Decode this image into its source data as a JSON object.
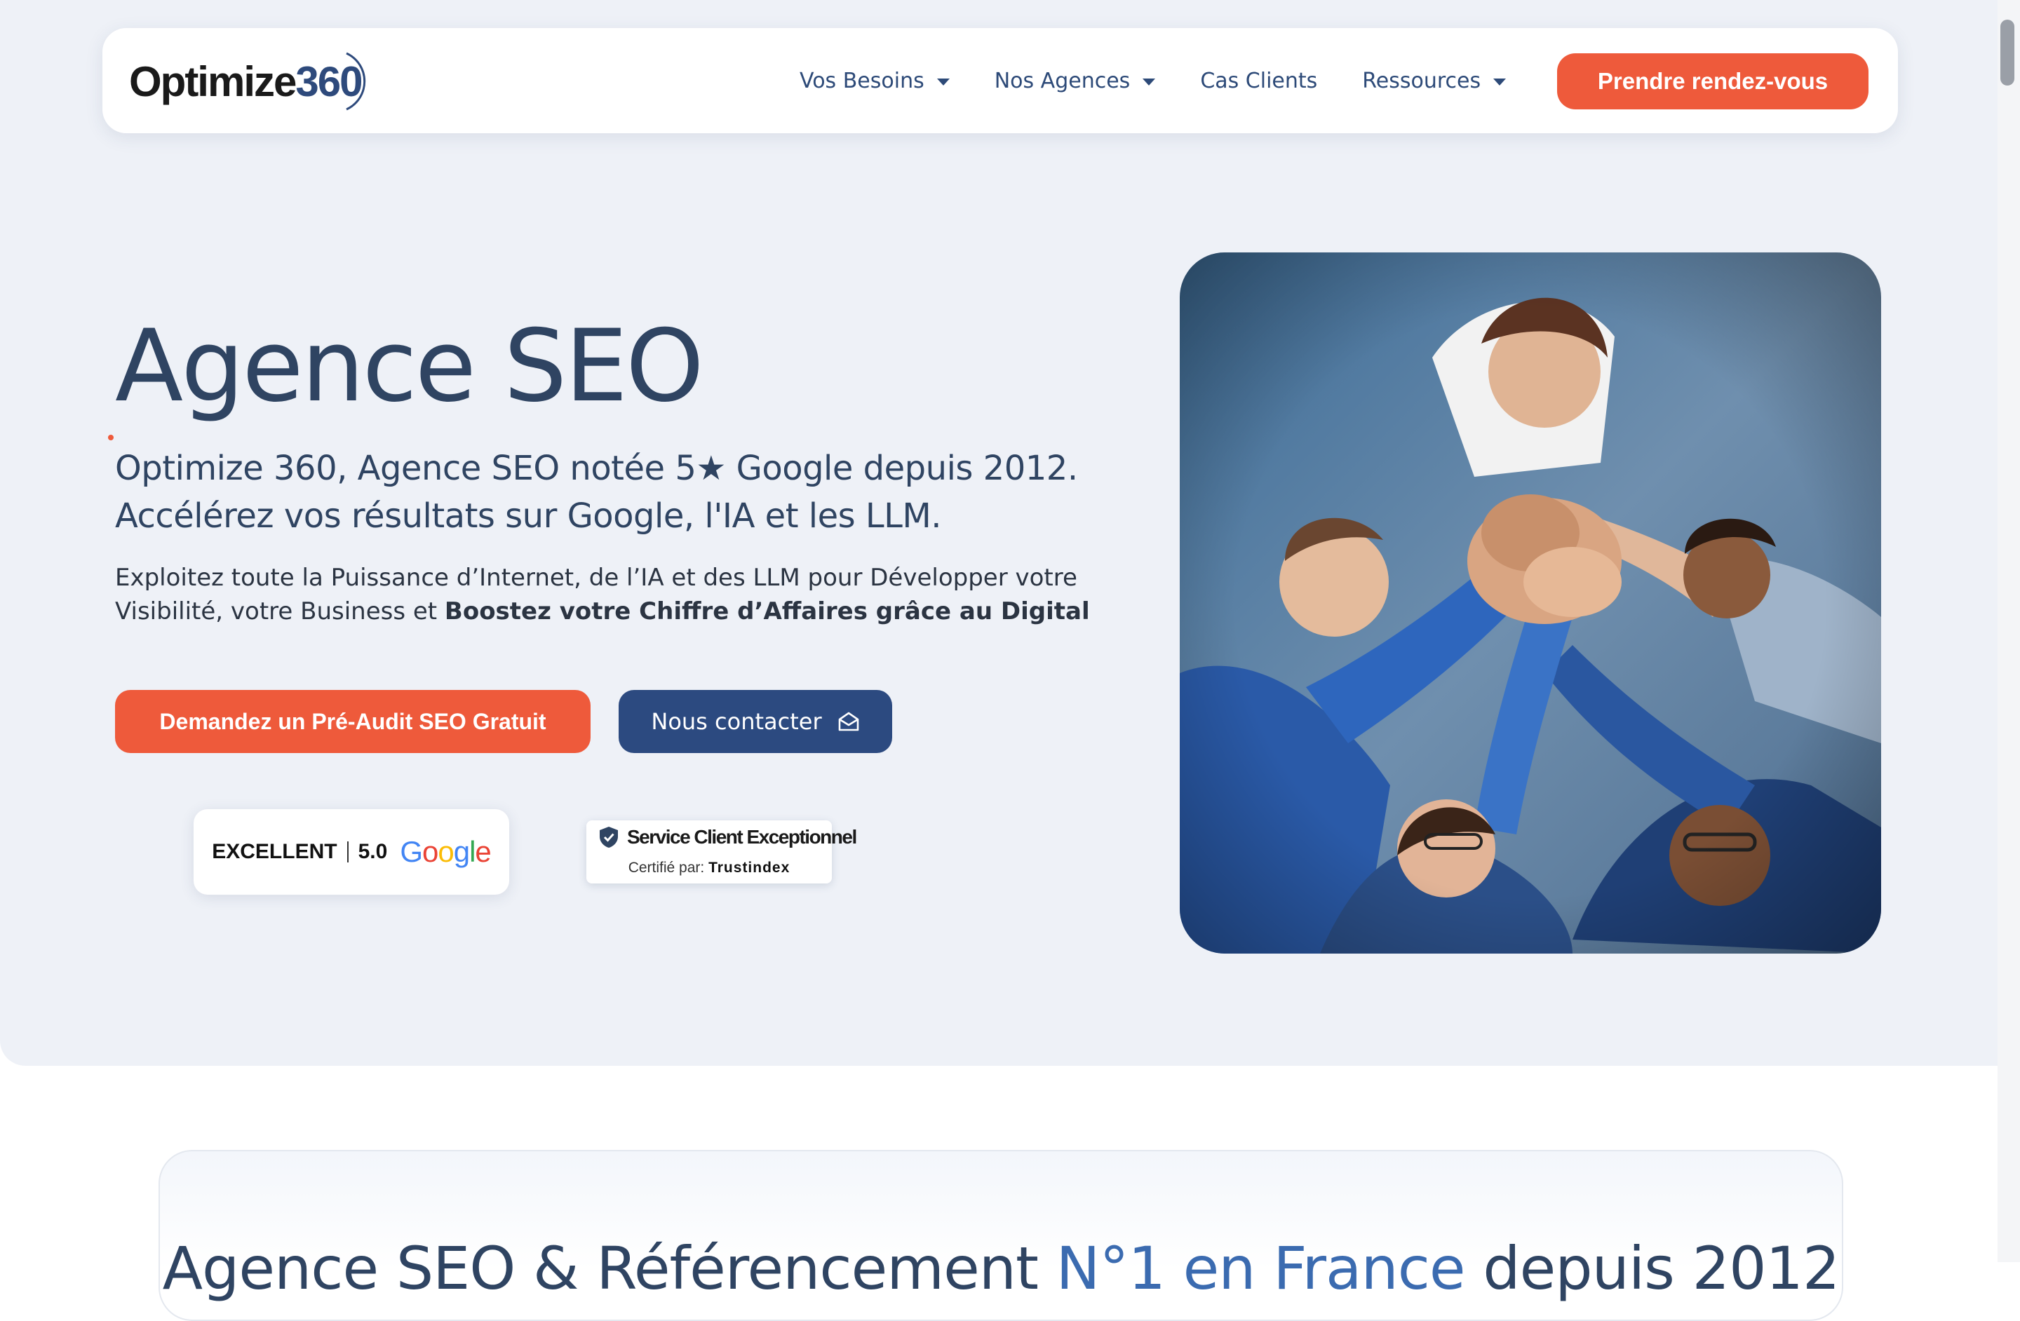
{
  "header": {
    "logo": {
      "text": "Optimize",
      "number": "360"
    },
    "nav": [
      {
        "label": "Vos Besoins",
        "dropdown": true
      },
      {
        "label": "Nos Agences",
        "dropdown": true
      },
      {
        "label": "Cas Clients",
        "dropdown": false
      },
      {
        "label": "Ressources",
        "dropdown": true
      }
    ],
    "cta_label": "Prendre rendez-vous"
  },
  "hero": {
    "title": "Agence SEO",
    "subtitle_line1": "Optimize 360, Agence SEO notée 5★ Google depuis 2012.",
    "subtitle_line2": "Accélérez vos résultats sur Google, l'IA et les LLM.",
    "desc_line1": "Exploitez toute la Puissance d’Internet, de l’IA et des LLM pour Développer votre",
    "desc_line2_plain": "Visibilité, votre Business et ",
    "desc_line2_bold": "Boostez votre Chiffre d’Affaires grâce au Digital",
    "btn_audit": "Demandez un Pré-Audit SEO Gratuit",
    "btn_contact": "Nous contacter",
    "image_alt": "team-high-five-photo"
  },
  "badges": {
    "google": {
      "label": "EXCELLENT",
      "score": "5.0",
      "brand": "Google"
    },
    "trustindex": {
      "title": "Service Client Exceptionnel",
      "certified_by": "Certifié par:",
      "brand": "Trustindex"
    }
  },
  "section2": {
    "title_before": "Agence SEO & Référencement ",
    "title_accent": "N°1 en France",
    "title_after": " depuis 2012"
  },
  "colors": {
    "accent_orange": "#ee5a3b",
    "navy": "#2c4a80",
    "hero_bg": "#eef1f7",
    "text_dark": "#2f4462"
  }
}
